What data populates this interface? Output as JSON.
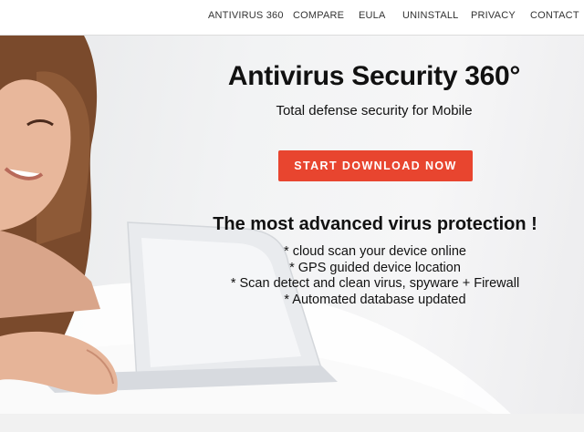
{
  "nav": {
    "items": [
      {
        "label": "ANTIVIRUS 360"
      },
      {
        "label": "COMPARE"
      },
      {
        "label": "EULA"
      },
      {
        "label": "UNINSTALL"
      },
      {
        "label": "PRIVACY"
      },
      {
        "label": "CONTACT"
      }
    ]
  },
  "hero": {
    "title": "Antivirus Security 360°",
    "subtitle": "Total defense security for Mobile",
    "cta_label": "START DOWNLOAD NOW",
    "headline": "The most advanced virus protection !",
    "features": [
      "* cloud scan your device online",
      "* GPS guided device location",
      "* Scan detect and clean virus, spyware + Firewall",
      "* Automated database updated"
    ]
  },
  "colors": {
    "accent": "#e8452f",
    "text": "#111111",
    "nav_text": "#333333"
  }
}
